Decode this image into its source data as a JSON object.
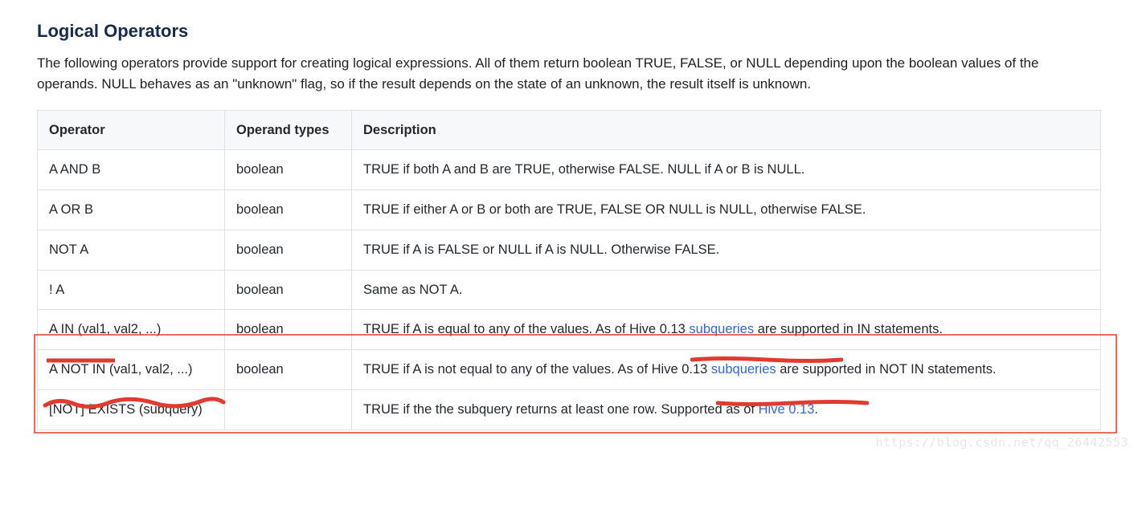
{
  "section": {
    "title": "Logical Operators",
    "intro": "The following operators provide support for creating logical expressions. All of them return boolean TRUE, FALSE, or NULL depending upon the boolean values of the operands. NULL behaves as an \"unknown\" flag, so if the result depends on the state of an unknown, the result itself is unknown."
  },
  "table": {
    "headers": {
      "operator": "Operator",
      "operand_types": "Operand types",
      "description": "Description"
    },
    "rows": [
      {
        "operator": "A AND B",
        "types": "boolean",
        "desc_pre": "TRUE if both A and B are TRUE, otherwise FALSE. NULL if A or B is NULL.",
        "link": "",
        "desc_post": ""
      },
      {
        "operator": "A OR B",
        "types": "boolean",
        "desc_pre": "TRUE if either A or B or both are TRUE, FALSE OR NULL is NULL, otherwise FALSE.",
        "link": "",
        "desc_post": ""
      },
      {
        "operator": "NOT A",
        "types": "boolean",
        "desc_pre": "TRUE if A is FALSE or NULL if A is NULL. Otherwise FALSE.",
        "link": "",
        "desc_post": ""
      },
      {
        "operator": "! A",
        "types": "boolean",
        "desc_pre": "Same as NOT A.",
        "link": "",
        "desc_post": ""
      },
      {
        "operator": "A IN (val1, val2, ...)",
        "types": "boolean",
        "desc_pre": "TRUE if A is equal to any of the values. As of Hive 0.13 ",
        "link": "subqueries",
        "desc_post": " are supported in IN statements."
      },
      {
        "operator": "A NOT IN (val1, val2, ...)",
        "types": "boolean",
        "desc_pre": "TRUE if A is not equal to any of the values. As of Hive 0.13 ",
        "link": "subqueries",
        "desc_post": " are supported in NOT IN statements."
      },
      {
        "operator": "[NOT] EXISTS (subquery)",
        "types": "",
        "desc_pre": "TRUE if the the subquery returns at least one row. Supported as of ",
        "link": "Hive 0.13",
        "desc_post": "."
      }
    ]
  },
  "annotation_color": "#e23a2e",
  "watermark": "https://blog.csdn.net/qq_26442553"
}
